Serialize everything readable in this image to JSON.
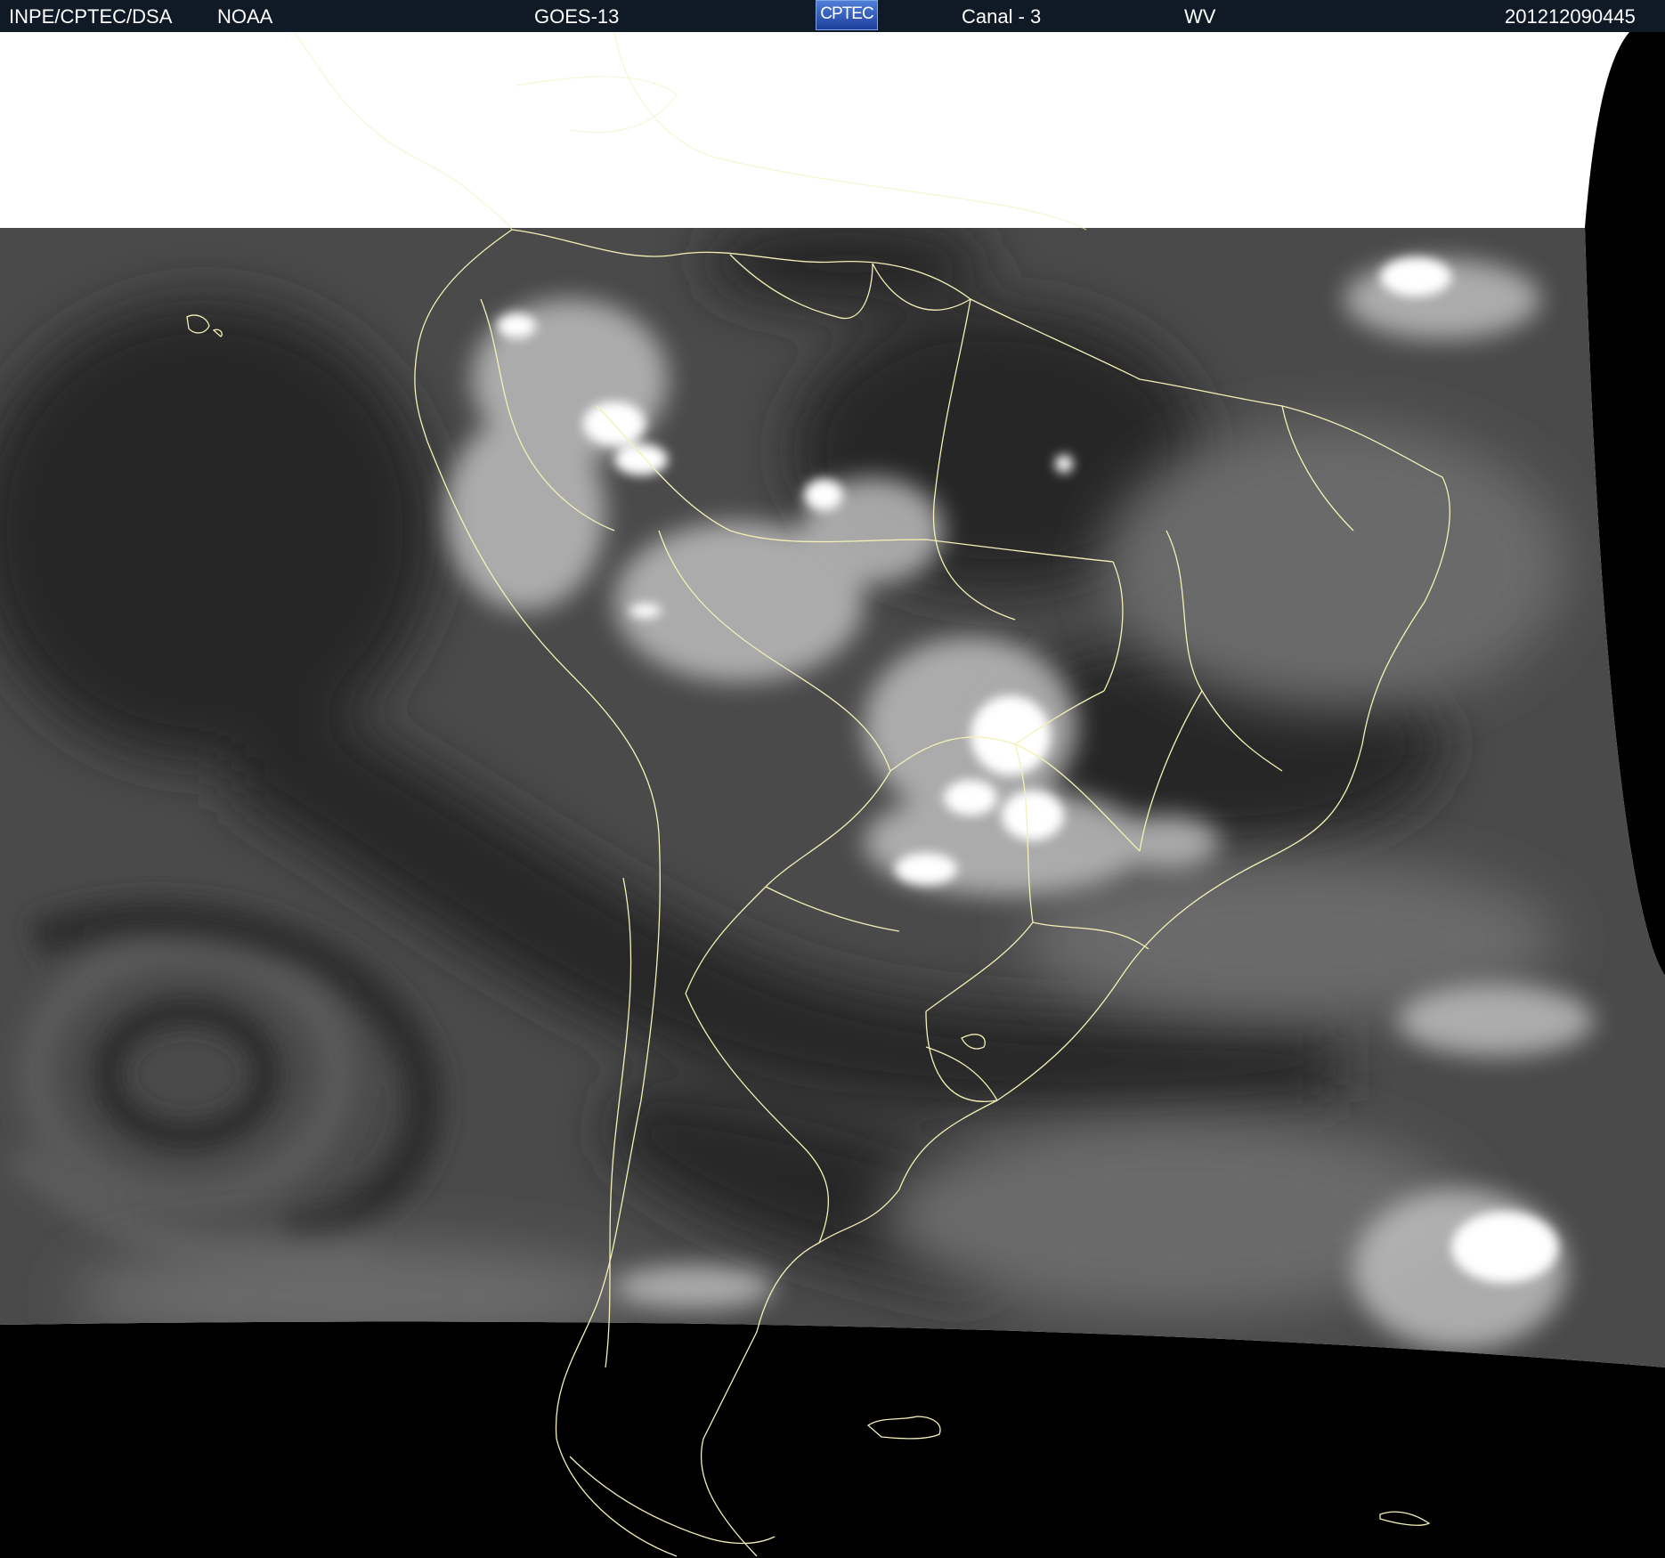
{
  "header": {
    "institution": "INPE/CPTEC/DSA",
    "agency": "NOAA",
    "satellite": "GOES-13",
    "logo_text": "CPTEC",
    "channel": "Canal - 3",
    "band": "WV",
    "timestamp": "201212090445"
  },
  "colors": {
    "header_bg": "#0f1a26",
    "coastline": "#f4f0b8",
    "space": "#000000",
    "no_data": "#ffffff"
  }
}
